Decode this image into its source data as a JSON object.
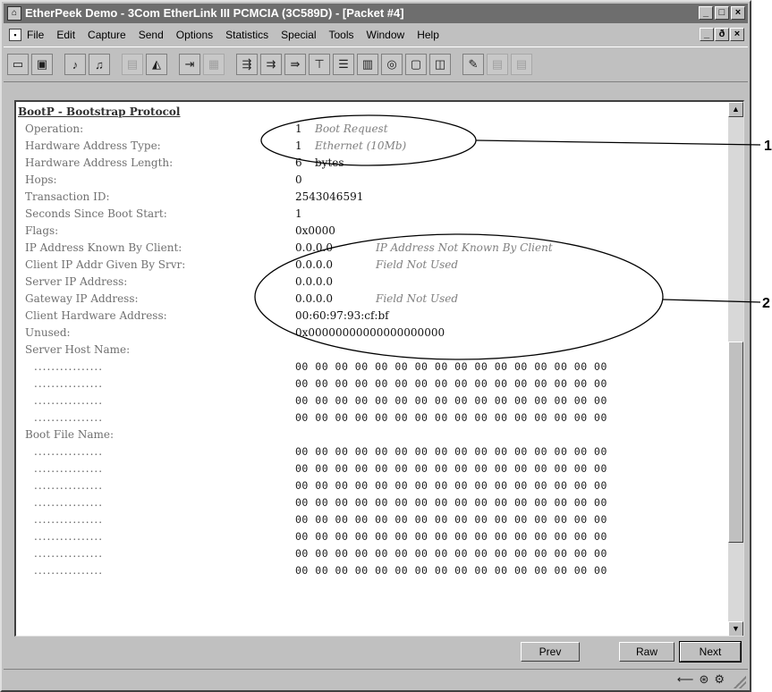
{
  "window": {
    "title": "EtherPeek Demo - 3Com EtherLink III PCMCIA (3C589D) - [Packet #4]",
    "controls": [
      "_",
      "□",
      "×"
    ],
    "mdi_controls": [
      "_",
      "ð",
      "×"
    ]
  },
  "menu": [
    "File",
    "Edit",
    "Capture",
    "Send",
    "Options",
    "Statistics",
    "Special",
    "Tools",
    "Window",
    "Help"
  ],
  "toolbar": {
    "buttons": [
      "open-icon",
      "save-icon",
      "capture-start-icon",
      "capture-stop-icon",
      "print-icon",
      "find-icon",
      "decode-icon",
      "filter-icon",
      "packets-icon",
      "nodes-icon",
      "protocols-icon",
      "size-icon",
      "conversation-icon",
      "history-icon",
      "alarm-icon",
      "monitor-icon",
      "log-icon",
      "notes-icon",
      "page1-icon",
      "page2-icon"
    ]
  },
  "decode": {
    "section_title": "BootP - Bootstrap Protocol",
    "fields": [
      {
        "label": "Operation:",
        "value": "1",
        "desc": "Boot Request"
      },
      {
        "label": "Hardware Address Type:",
        "value": "1",
        "desc": "Ethernet (10Mb)"
      },
      {
        "label": "Hardware Address Length:",
        "value": "6",
        "desc": "bytes"
      },
      {
        "label": "Hops:",
        "value": "0",
        "desc": ""
      },
      {
        "label": "Transaction ID:",
        "value": "2543046591",
        "desc": ""
      },
      {
        "label": "Seconds Since Boot Start:",
        "value": "1",
        "desc": ""
      },
      {
        "label": "Flags:",
        "value": "0x0000",
        "desc": ""
      },
      {
        "label": "IP Address Known By Client:",
        "value": "0.0.0.0",
        "desc": "IP Address Not Known By Client"
      },
      {
        "label": "Client IP Addr Given By Srvr:",
        "value": "0.0.0.0",
        "desc": "Field Not Used"
      },
      {
        "label": "Server IP Address:",
        "value": "0.0.0.0",
        "desc": ""
      },
      {
        "label": "Gateway IP Address:",
        "value": "0.0.0.0",
        "desc": "Field Not Used"
      },
      {
        "label": "Client Hardware Address:",
        "value": "00:60:97:93:cf:bf",
        "desc": ""
      },
      {
        "label": "Unused:",
        "value": "0x00000000000000000000",
        "desc": ""
      }
    ],
    "server_host_name_label": "Server Host Name:",
    "boot_file_name_label": "Boot File Name:",
    "dots": "................",
    "hex_line": "00 00 00 00 00 00 00 00 00 00 00 00 00 00 00 00"
  },
  "nav": {
    "prev": "Prev",
    "raw": "Raw",
    "next": "Next"
  },
  "status": {
    "icons": [
      "arrow-left-icon",
      "network-icon",
      "lock-icon"
    ]
  },
  "callouts": {
    "one": "1",
    "two": "2"
  }
}
